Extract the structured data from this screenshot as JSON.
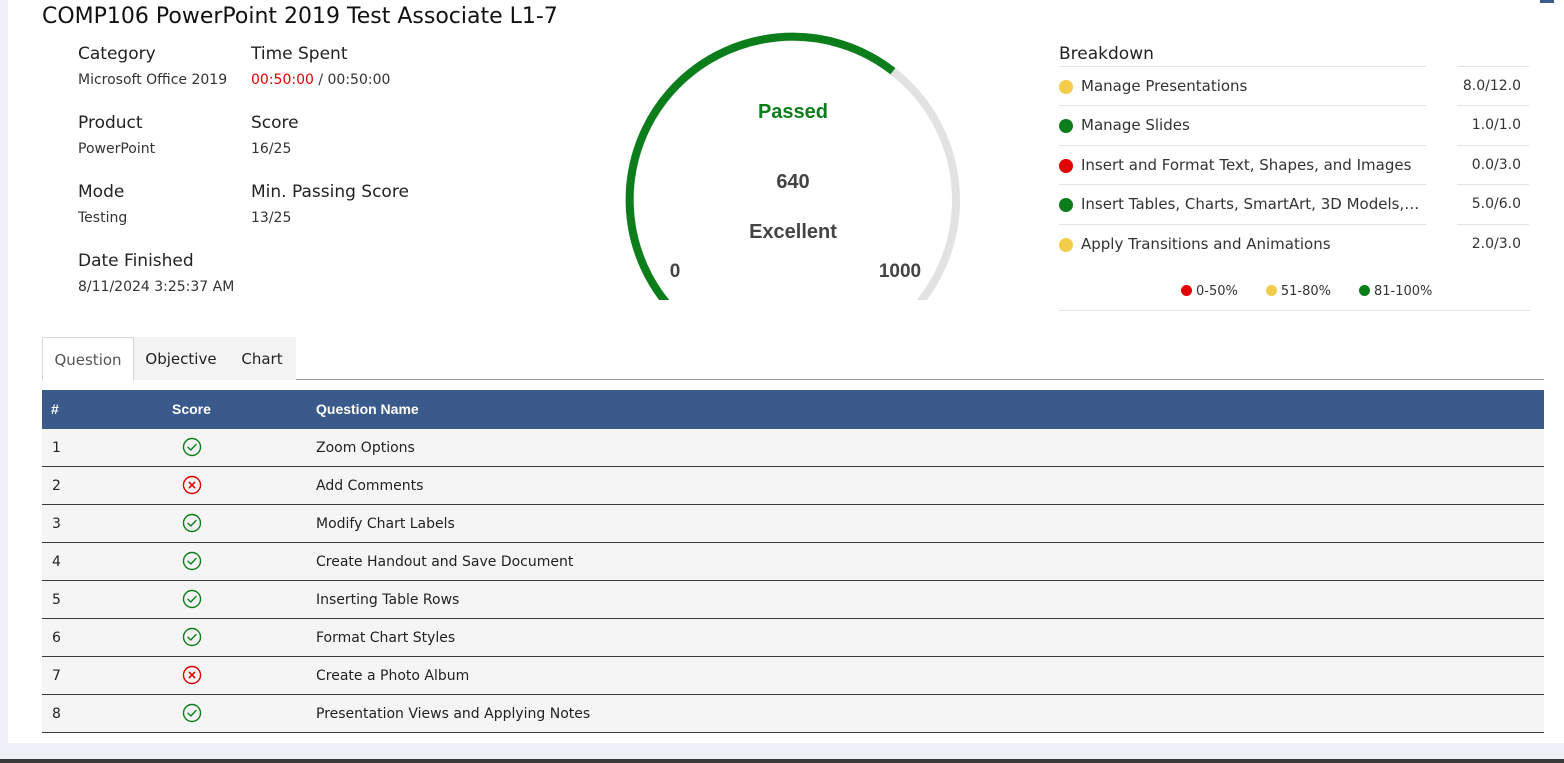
{
  "page": {
    "title": "COMP106 PowerPoint 2019 Test Associate L1-7"
  },
  "info": {
    "category": {
      "label": "Category",
      "value": "Microsoft Office 2019"
    },
    "time_spent": {
      "label": "Time Spent",
      "elapsed": "00:50:00",
      "separator": " / ",
      "limit": "00:50:00"
    },
    "product": {
      "label": "Product",
      "value": "PowerPoint"
    },
    "score": {
      "label": "Score",
      "value": "16/25"
    },
    "mode": {
      "label": "Mode",
      "value": "Testing"
    },
    "min_passing": {
      "label": "Min. Passing Score",
      "value": "13/25"
    },
    "date_finished": {
      "label": "Date Finished",
      "value": "8/11/2024 3:25:37 AM"
    }
  },
  "gauge": {
    "status": "Passed",
    "value": 640,
    "value_text": "640",
    "rating": "Excellent",
    "min_label": "0",
    "max_label": "1000",
    "min": 0,
    "max": 1000,
    "colors": {
      "fill": "#0b7e1b",
      "track": "#e2e2e2",
      "status": "#0b7e1b",
      "text": "#444444"
    }
  },
  "breakdown": {
    "title": "Breakdown",
    "items": [
      {
        "name": "Manage Presentations",
        "score": "8.0/12.0",
        "color": "#f2cc4b"
      },
      {
        "name": "Manage Slides",
        "score": "1.0/1.0",
        "color": "#0b7e1b"
      },
      {
        "name": "Insert and Format Text, Shapes, and Images",
        "score": "0.0/3.0",
        "color": "#e00000"
      },
      {
        "name": "Insert Tables, Charts, SmartArt, 3D Models, an...",
        "score": "5.0/6.0",
        "color": "#0b7e1b"
      },
      {
        "name": "Apply Transitions and Animations",
        "score": "2.0/3.0",
        "color": "#f2cc4b"
      }
    ],
    "legend": [
      {
        "label": "0-50%",
        "color": "#e00000"
      },
      {
        "label": "51-80%",
        "color": "#f2cc4b"
      },
      {
        "label": "81-100%",
        "color": "#0b7e1b"
      }
    ]
  },
  "tabs": [
    {
      "label": "Question",
      "active": true
    },
    {
      "label": "Objective",
      "active": false
    },
    {
      "label": "Chart",
      "active": false
    }
  ],
  "table": {
    "headers": {
      "num": "#",
      "score": "Score",
      "name": "Question Name"
    },
    "rows": [
      {
        "num": "1",
        "correct": true,
        "name": "Zoom Options"
      },
      {
        "num": "2",
        "correct": false,
        "name": "Add Comments"
      },
      {
        "num": "3",
        "correct": true,
        "name": "Modify Chart Labels"
      },
      {
        "num": "4",
        "correct": true,
        "name": "Create Handout and Save Document"
      },
      {
        "num": "5",
        "correct": true,
        "name": "Inserting Table Rows"
      },
      {
        "num": "6",
        "correct": true,
        "name": "Format Chart Styles"
      },
      {
        "num": "7",
        "correct": false,
        "name": "Create a Photo Album"
      },
      {
        "num": "8",
        "correct": true,
        "name": "Presentation Views and Applying Notes"
      }
    ],
    "colors": {
      "header_bg": "#3a5a8c",
      "correct": "#0b7e1b",
      "incorrect": "#e00000"
    }
  }
}
